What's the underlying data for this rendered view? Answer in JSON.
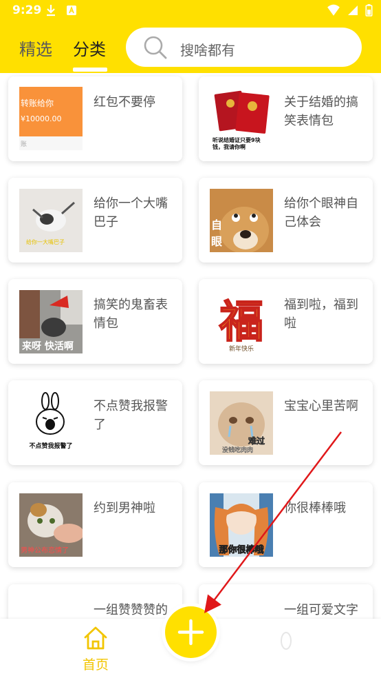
{
  "status_bar": {
    "time": "9:29"
  },
  "header": {
    "tabs": [
      {
        "label": "精选"
      },
      {
        "label": "分类"
      }
    ],
    "search": {
      "placeholder": "搜啥都有"
    }
  },
  "cards": [
    {
      "title": "红包不要停",
      "thumb_text": "转账给你",
      "thumb_amount": "¥10000.00",
      "thumb_foot": "账"
    },
    {
      "title": "关于结婚的搞笑表情包",
      "thumb_caption_1": "听说结婚证只要9块",
      "thumb_caption_2": "钱，我请你啊"
    },
    {
      "title": "给你一个大嘴巴子",
      "thumb_caption": "给你一大嘴巴子"
    },
    {
      "title": "给你个眼神自己体会",
      "thumb_side_1": "自",
      "thumb_side_2": "眼"
    },
    {
      "title": "搞笑的鬼畜表情包",
      "thumb_caption": "来呀 快活啊"
    },
    {
      "title": "福到啦，福到啦",
      "thumb_big": "福",
      "thumb_small": "新年快乐"
    },
    {
      "title": "不点赞我报警了",
      "thumb_caption": "不点赞我报警了"
    },
    {
      "title": "宝宝心里苦啊",
      "thumb_caption_1": "难过",
      "thumb_caption_2": "没钱吃肉肉"
    },
    {
      "title": "约到男神啦",
      "thumb_caption": "男神公布恋情了"
    },
    {
      "title": "你很棒棒哦",
      "thumb_caption": "那你很棒哦"
    },
    {
      "title": "一组赞赞赞的"
    },
    {
      "title": "一组可爱文字"
    }
  ],
  "bottom_nav": {
    "home_label": "首页"
  },
  "colors": {
    "brand_yellow": "#FFE000",
    "nav_active": "#F2C500",
    "arrow_red": "#E0181A"
  }
}
